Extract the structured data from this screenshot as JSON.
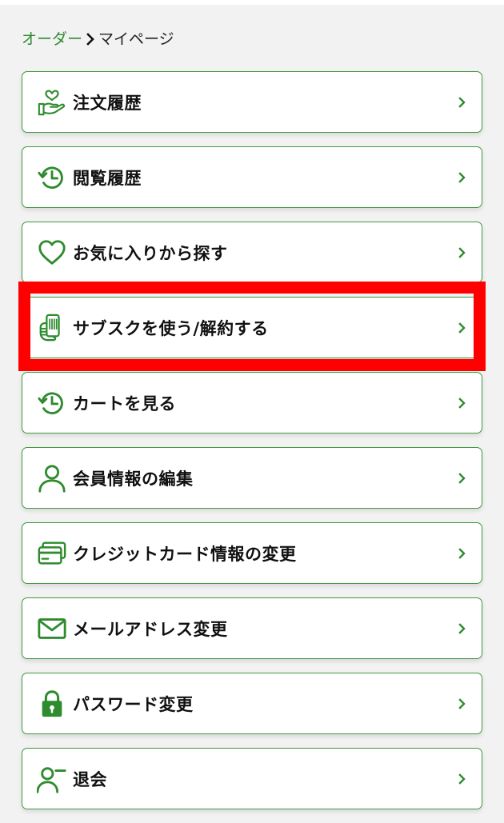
{
  "breadcrumb": {
    "parent_label": "オーダー",
    "current_label": "マイページ"
  },
  "menu": {
    "items": [
      {
        "label": "注文履歴",
        "icon": "hand-heart-icon"
      },
      {
        "label": "閲覧履歴",
        "icon": "history-icon"
      },
      {
        "label": "お気に入りから探す",
        "icon": "heart-outline-icon"
      },
      {
        "label": "サブスクを使う/解約する",
        "icon": "phone-in-hand-icon"
      },
      {
        "label": "カートを見る",
        "icon": "history-icon"
      },
      {
        "label": "会員情報の編集",
        "icon": "person-icon"
      },
      {
        "label": "クレジットカード情報の変更",
        "icon": "credit-card-icon"
      },
      {
        "label": "メールアドレス変更",
        "icon": "envelope-icon"
      },
      {
        "label": "パスワード変更",
        "icon": "lock-icon"
      },
      {
        "label": "退会",
        "icon": "person-remove-icon"
      }
    ]
  },
  "highlight": {
    "target_item": "サブスクを使う/解約する",
    "color": "#ff0000"
  },
  "colors": {
    "accent_green": "#3f9a3f",
    "breadcrumb_link": "#2e8b2e",
    "background": "#f2f2f2"
  }
}
